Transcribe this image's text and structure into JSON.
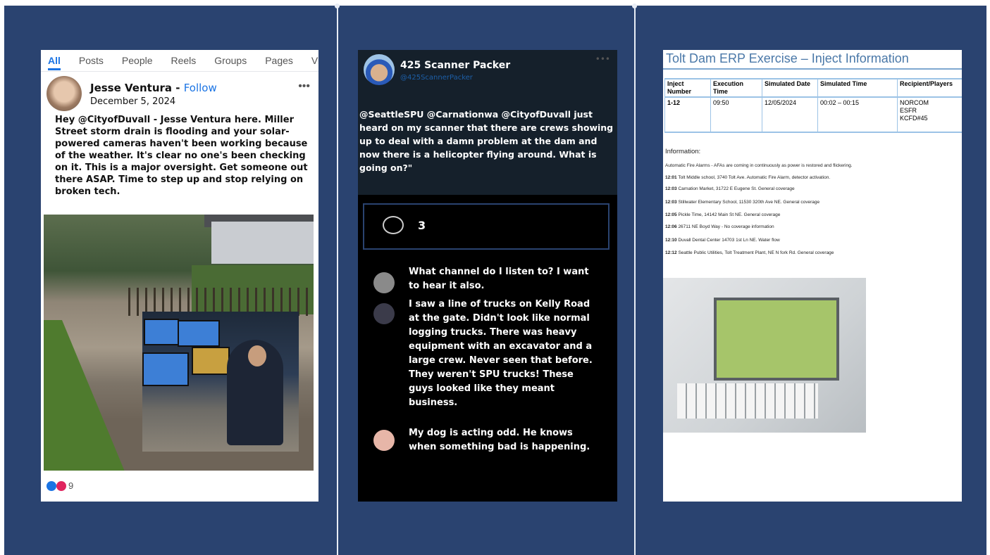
{
  "facebook": {
    "tabs": [
      "All",
      "Posts",
      "People",
      "Reels",
      "Groups",
      "Pages",
      "Vi"
    ],
    "author": "Jesse Ventura",
    "separator": " - ",
    "follow": "Follow",
    "date": "December 5, 2024",
    "more": "•••",
    "post": "Hey @CityofDuvall - Jesse Ventura here. Miller Street storm drain is flooding and your solar-powered cameras haven't been working because of the weather. It's clear no one's been checking on it. This is a major oversight. Get someone out there ASAP. Time to step up and stop relying on broken tech.",
    "reactions": "9"
  },
  "scanner": {
    "name": "425 Scanner Packer",
    "handle": "@425ScannerPacker",
    "more": "•••",
    "post": "@SeattleSPU @Carnationwa @CityofDuvall just heard on my scanner that there are crews showing up to deal with a damn problem at the dam and now there is a helicopter flying around. What is going on?\"",
    "comment_count": "3",
    "comments": [
      {
        "text": "What channel do I listen to? I want to hear it also."
      },
      {
        "text": "I saw a line of trucks on Kelly Road at the gate. Didn't look like normal logging trucks. There was heavy equipment with an excavator and a large crew. Never seen that before. They weren't SPU trucks! These guys looked like they meant business."
      },
      {
        "text": "My dog is acting odd. He knows when something bad is happening."
      }
    ]
  },
  "inject": {
    "title": "Tolt Dam ERP Exercise – Inject Information",
    "headers": [
      "Inject Number",
      "Execution Time",
      "Simulated Date",
      "Simulated Time",
      "Recipient/Players"
    ],
    "row": {
      "number": "1-12",
      "exec_time": "09:50",
      "sim_date": "12/05/2024",
      "sim_time": "00:02 – 00:15",
      "recipients": [
        "NORCOM",
        "ESFR",
        "KCFD#45"
      ]
    },
    "info_label": "Information:",
    "lines": [
      {
        "time": "",
        "text": "Automatic Fire Alarms - AFAs are coming in continuously as power is restored and flickering."
      },
      {
        "time": "12:01",
        "text": "Tolt Middle school, 3740 Tolt Ave. Automatic Fire Alarm, detector activation."
      },
      {
        "time": "12:03",
        "text": "Carnation Market, 31722 E Eugene St. General coverage"
      },
      {
        "time": "12:03",
        "text": "Stillwater Elementary School, 11530 320th Ave NE. General coverage"
      },
      {
        "time": "12:05",
        "text": "Pickle Time, 14142 Main St NE. General coverage"
      },
      {
        "time": "12:06",
        "text": "26711 NE Boyd Way - No coverage information"
      },
      {
        "time": "12:10",
        "text": "Duvall Dental Center 14703 1st Ln NE. Water flow"
      },
      {
        "time": "12:12",
        "text": "Seattle Public Utilities, Tolt Treatment Plant, NE N fork Rd. General coverage"
      }
    ]
  }
}
